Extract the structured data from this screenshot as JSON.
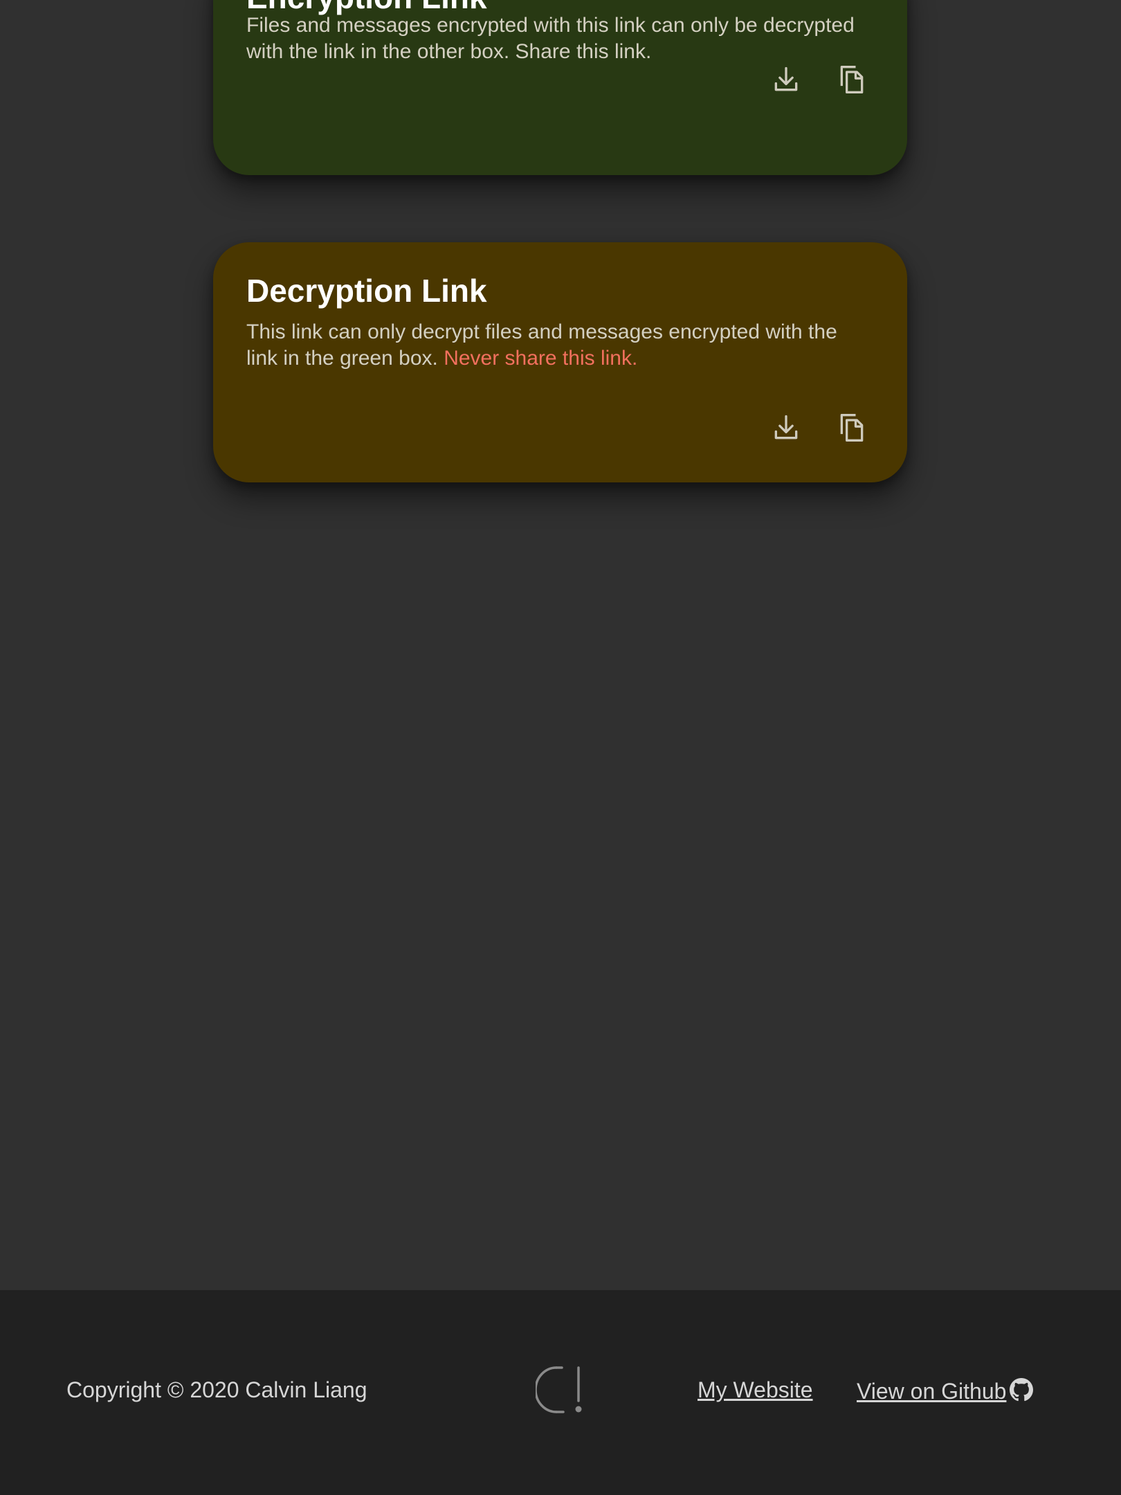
{
  "encryption_card": {
    "title": "Encryption Link",
    "description": "Files and messages encrypted with this link can only be decrypted with the link in the other box. Share this link.",
    "icons": [
      "download-icon",
      "copy-icon"
    ],
    "bg_color": "#283913"
  },
  "decryption_card": {
    "title": "Decryption Link",
    "description": "This link can only decrypt files and messages encrypted with the link in the green box.",
    "warning": "Never share this link.",
    "icons": [
      "download-icon",
      "copy-icon"
    ],
    "bg_color": "#4a3700",
    "warning_color": "#f2705e"
  },
  "footer": {
    "copyright": "Copyright © 2020 Calvin Liang",
    "logo_icon": "logo-icon",
    "links": {
      "website": "My Website",
      "github": "View on Github"
    },
    "github_icon": "github-icon"
  }
}
